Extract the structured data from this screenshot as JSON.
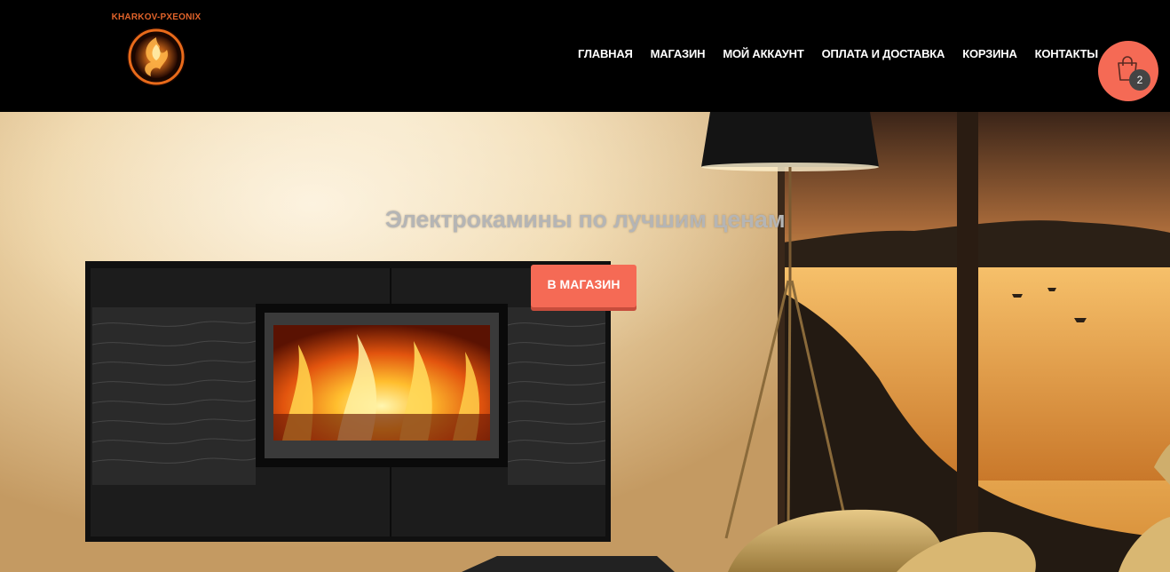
{
  "header": {
    "logo_text": "KHARKOV-PXEONIX",
    "nav": [
      {
        "label": "ГЛАВНАЯ"
      },
      {
        "label": "МАГАЗИН"
      },
      {
        "label": "МОЙ АККАУНТ"
      },
      {
        "label": "ОПЛАТА И ДОСТАВКА"
      },
      {
        "label": "КОРЗИНА"
      },
      {
        "label": "КОНТАКТЫ"
      }
    ],
    "cart": {
      "icon": "shopping-bag-icon",
      "count": "2"
    }
  },
  "hero": {
    "title": "Электрокамины по лучшим ценам",
    "button_label": "В МАГАЗИН"
  },
  "colors": {
    "header_bg": "#000000",
    "accent": "#f56a55",
    "cart_badge": "#444444",
    "nav_text": "#ffffff"
  }
}
